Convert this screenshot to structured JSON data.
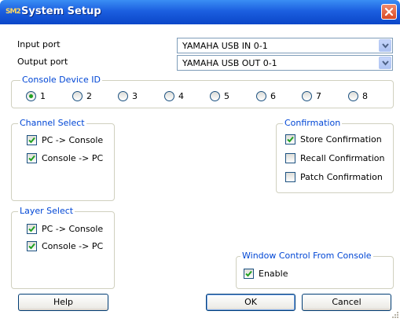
{
  "window": {
    "title": "System Setup",
    "icon_text": "SM2"
  },
  "ports": {
    "input_label": "Input port",
    "input_value": "YAMAHA USB IN 0-1",
    "output_label": "Output port",
    "output_value": "YAMAHA USB OUT 0-1"
  },
  "console_device_id": {
    "title": "Console Device ID",
    "options": [
      "1",
      "2",
      "3",
      "4",
      "5",
      "6",
      "7",
      "8"
    ],
    "selected": "1"
  },
  "channel_select": {
    "title": "Channel Select",
    "items": [
      {
        "label": "PC -> Console",
        "checked": true
      },
      {
        "label": "Console -> PC",
        "checked": true
      }
    ]
  },
  "confirmation": {
    "title": "Confirmation",
    "items": [
      {
        "label": "Store Confirmation",
        "checked": true
      },
      {
        "label": "Recall Confirmation",
        "checked": false
      },
      {
        "label": "Patch Confirmation",
        "checked": false
      }
    ]
  },
  "layer_select": {
    "title": "Layer Select",
    "items": [
      {
        "label": "PC -> Console",
        "checked": true
      },
      {
        "label": "Console -> PC",
        "checked": true
      }
    ]
  },
  "window_control": {
    "title": "Window Control From Console",
    "enable_label": "Enable",
    "enable_checked": true
  },
  "buttons": {
    "help": "Help",
    "ok": "OK",
    "cancel": "Cancel"
  },
  "colors": {
    "titlebar": "#0a46c8",
    "group_title": "#0046d5",
    "check_mark": "#21a121"
  },
  "icons": [
    "app-icon",
    "close-icon",
    "dropdown-arrow-icon",
    "resize-grip-icon"
  ]
}
